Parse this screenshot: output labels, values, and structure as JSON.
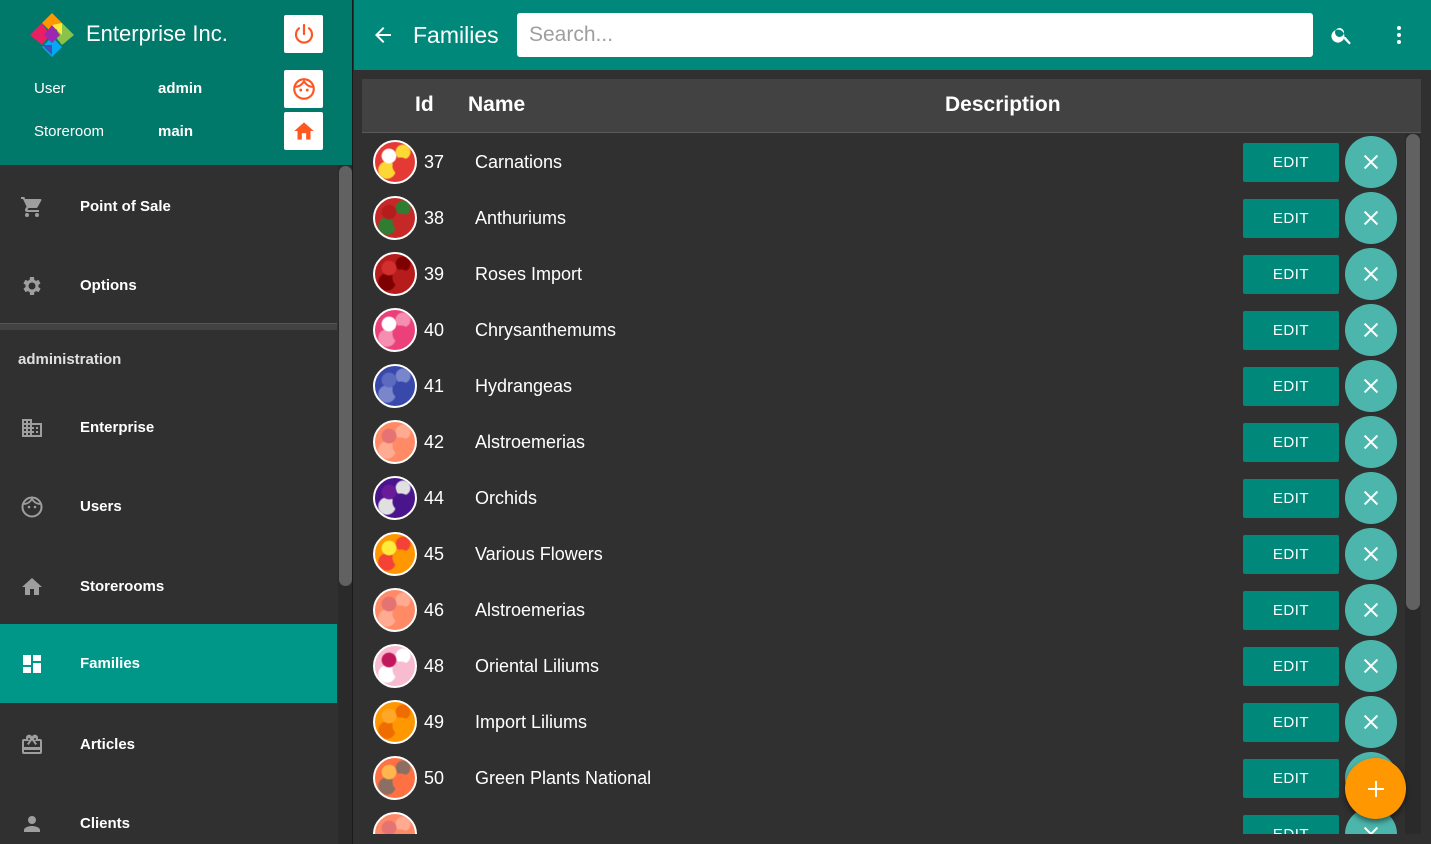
{
  "app": {
    "name": "Enterprise Inc.",
    "user_label": "User",
    "user_value": "admin",
    "storeroom_label": "Storeroom",
    "storeroom_value": "main"
  },
  "sidebar": {
    "items": [
      {
        "label": "Point of Sale",
        "icon": "cart-icon"
      },
      {
        "label": "Options",
        "icon": "gear-icon"
      }
    ],
    "admin_header": "administration",
    "admin_items": [
      {
        "label": "Enterprise",
        "icon": "building-icon"
      },
      {
        "label": "Users",
        "icon": "face-icon"
      },
      {
        "label": "Storerooms",
        "icon": "home-icon"
      },
      {
        "label": "Families",
        "icon": "dashboard-icon",
        "active": true
      },
      {
        "label": "Articles",
        "icon": "gift-card-icon"
      },
      {
        "label": "Clients",
        "icon": "person-icon"
      }
    ]
  },
  "topbar": {
    "title": "Families",
    "search_placeholder": "Search..."
  },
  "table": {
    "headers": {
      "id": "Id",
      "name": "Name",
      "description": "Description"
    },
    "edit_label": "EDIT",
    "rows": [
      {
        "id": "37",
        "name": "Carnations",
        "colors": [
          "#e53935",
          "#fdd835",
          "#ffffff"
        ]
      },
      {
        "id": "38",
        "name": "Anthuriums",
        "colors": [
          "#c62828",
          "#2e7d32",
          "#b71c1c"
        ]
      },
      {
        "id": "39",
        "name": "Roses Import",
        "colors": [
          "#b71c1c",
          "#7f0000",
          "#d32f2f"
        ]
      },
      {
        "id": "40",
        "name": "Chrysanthemums",
        "colors": [
          "#ec407a",
          "#f48fb1",
          "#ffffff"
        ]
      },
      {
        "id": "41",
        "name": "Hydrangeas",
        "colors": [
          "#3949ab",
          "#7986cb",
          "#5c6bc0"
        ]
      },
      {
        "id": "42",
        "name": "Alstroemerias",
        "colors": [
          "#ff8a65",
          "#ffab91",
          "#e57373"
        ]
      },
      {
        "id": "44",
        "name": "Orchids",
        "colors": [
          "#4a148c",
          "#e0e0e0",
          "#6a1b9a"
        ]
      },
      {
        "id": "45",
        "name": "Various Flowers",
        "colors": [
          "#ff9800",
          "#f44336",
          "#ffeb3b"
        ]
      },
      {
        "id": "46",
        "name": "Alstroemerias",
        "colors": [
          "#ff8a65",
          "#ffab91",
          "#e57373"
        ]
      },
      {
        "id": "48",
        "name": "Oriental Liliums",
        "colors": [
          "#f8bbd0",
          "#ffffff",
          "#c2185b"
        ]
      },
      {
        "id": "49",
        "name": "Import Liliums",
        "colors": [
          "#ff9800",
          "#ef6c00",
          "#ffa726"
        ]
      },
      {
        "id": "50",
        "name": "Green Plants National",
        "colors": [
          "#ff7043",
          "#8d6e63",
          "#ffb74d"
        ]
      },
      {
        "id": "",
        "name": "",
        "colors": [
          "#ff8a65",
          "#ffab91",
          "#e57373"
        ]
      }
    ]
  },
  "colors": {
    "primary": "#00897b",
    "primary_dark": "#00796b",
    "active_nav": "#009688",
    "delete_button": "#4db6ac",
    "fab": "#ff9800",
    "accent_icon": "#ff5722"
  }
}
